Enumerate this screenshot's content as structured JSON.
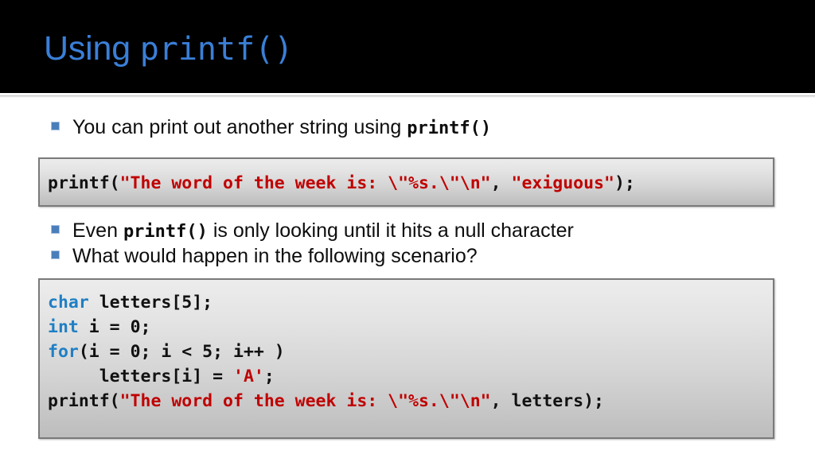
{
  "slide": {
    "title_plain": "Using ",
    "title_mono": "printf()",
    "title_color": "#3a7fd8",
    "band_color": "#000000"
  },
  "bullets": [
    {
      "id": "bullet-1",
      "pre": "You can print out another string using ",
      "code": "printf()",
      "post": ""
    },
    {
      "id": "bullet-2",
      "pre": "Even ",
      "code": "printf()",
      "post": " is only looking until it hits a null character"
    },
    {
      "id": "bullet-3",
      "pre": "What would happen in the following scenario?",
      "code": "",
      "post": ""
    }
  ],
  "code_blocks": [
    {
      "id": "code-box-1",
      "full_text": "printf(\"The word of the week is: \\\"%s.\\\"\\n\", \"exiguous\");",
      "lines": [
        {
          "spans": [
            {
              "text": "printf(",
              "type": "plain"
            },
            {
              "text": "\"The word of the week is: \\\"%s.\\\"\\n\"",
              "type": "string"
            },
            {
              "text": ", ",
              "type": "plain"
            },
            {
              "text": "\"exiguous\"",
              "type": "string"
            },
            {
              "text": ");",
              "type": "plain"
            }
          ]
        }
      ]
    },
    {
      "id": "code-box-2",
      "full_text": "char letters[5];\nint i = 0;\nfor(i = 0; i < 5; i++ )\n     letters[i] = 'A';\nprintf(\"The word of the week is: \\\"%s.\\\"\\n\", letters);",
      "lines": [
        {
          "spans": [
            {
              "text": "char",
              "type": "keyword"
            },
            {
              "text": " letters[5];",
              "type": "plain"
            }
          ]
        },
        {
          "spans": [
            {
              "text": "int",
              "type": "keyword"
            },
            {
              "text": " i = 0;",
              "type": "plain"
            }
          ]
        },
        {
          "spans": [
            {
              "text": "for",
              "type": "keyword"
            },
            {
              "text": "(i = 0; i < 5; i++ )",
              "type": "plain"
            }
          ]
        },
        {
          "spans": [
            {
              "text": "     letters[i] = ",
              "type": "plain"
            },
            {
              "text": "'A'",
              "type": "string"
            },
            {
              "text": ";",
              "type": "plain"
            }
          ]
        },
        {
          "spans": [
            {
              "text": "printf(",
              "type": "plain"
            },
            {
              "text": "\"The word of the week is: \\\"%s.\\\"\\n\"",
              "type": "string"
            },
            {
              "text": ", letters);",
              "type": "plain"
            }
          ]
        }
      ]
    }
  ],
  "colors": {
    "keyword": "#1f7fc4",
    "string": "#c00000",
    "code_fg": "#111111",
    "bullet_square": "#4a7ebb",
    "box_border": "#7a7a7a"
  }
}
